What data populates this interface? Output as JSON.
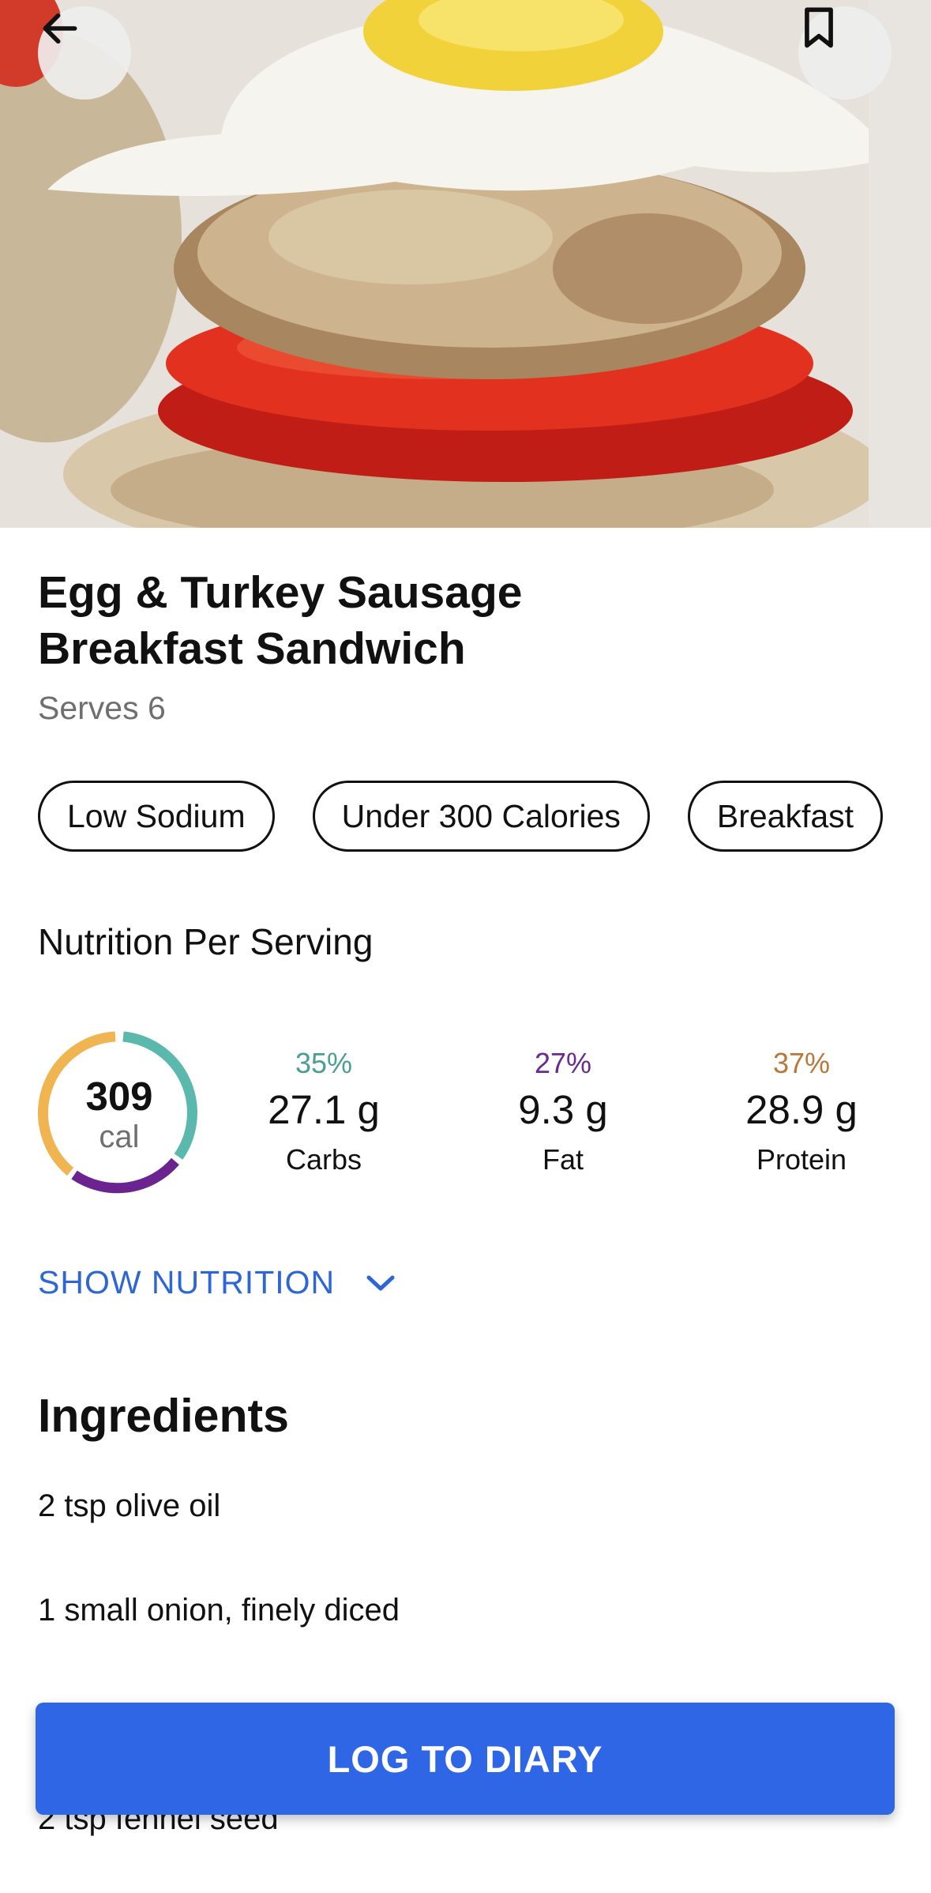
{
  "hero": {
    "image_alt": "sandwich-photo"
  },
  "nav": {
    "back_icon": "arrow-left-icon",
    "bookmark_icon": "bookmark-icon"
  },
  "recipe": {
    "title_line1": "Egg & Turkey Sausage",
    "title_line2": "Breakfast Sandwich",
    "serves": "Serves 6"
  },
  "tags": [
    "Low Sodium",
    "Under 300 Calories",
    "Breakfast"
  ],
  "nutrition": {
    "heading": "Nutrition Per Serving",
    "calories": "309",
    "calories_unit": "cal",
    "macros": [
      {
        "pct": "35%",
        "amount": "27.1 g",
        "label": "Carbs",
        "color": "#4fb3a6"
      },
      {
        "pct": "27%",
        "amount": "9.3 g",
        "label": "Fat",
        "color": "#6a2a8f"
      },
      {
        "pct": "37%",
        "amount": "28.9 g",
        "label": "Protein",
        "color": "#b8783a"
      }
    ],
    "ring_colors": {
      "carbs": "#5bb8ad",
      "fat": "#6b2390",
      "protein": "#f0b450"
    },
    "show_label": "SHOW NUTRITION"
  },
  "ingredients": {
    "heading": "Ingredients",
    "items": [
      "2 tsp olive oil",
      "1 small onion, finely diced",
      "2 tsp fennel seed"
    ]
  },
  "cta": {
    "label": "LOG TO DIARY",
    "color": "#2f66e6"
  }
}
